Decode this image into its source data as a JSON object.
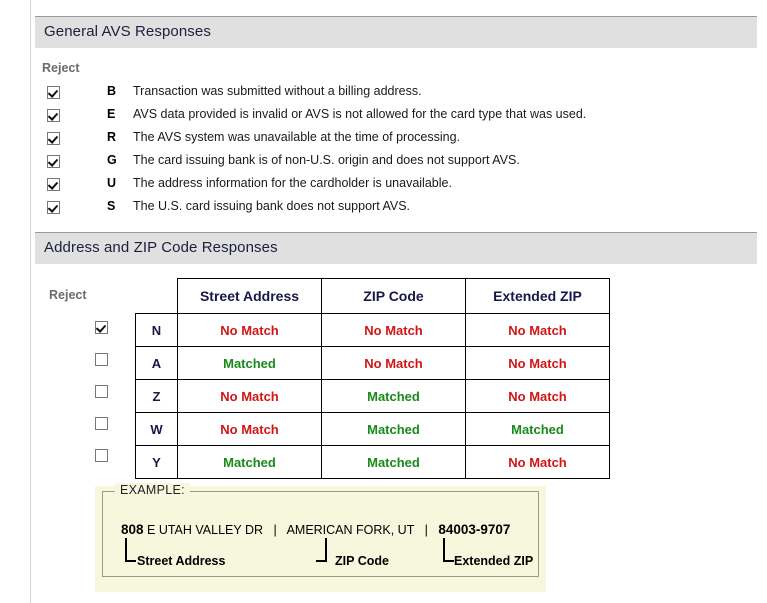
{
  "sections": {
    "general": {
      "title": "General AVS Responses",
      "reject_label": "Reject",
      "rows": [
        {
          "checked": true,
          "code": "B",
          "text": "Transaction was submitted without a billing address."
        },
        {
          "checked": true,
          "code": "E",
          "text": "AVS data provided is invalid or AVS is not allowed for the card type that was used."
        },
        {
          "checked": true,
          "code": "R",
          "text": "The AVS system was unavailable at the time of processing."
        },
        {
          "checked": true,
          "code": "G",
          "text": "The card issuing bank is of non-U.S. origin and does not support AVS."
        },
        {
          "checked": true,
          "code": "U",
          "text": "The address information for the cardholder is unavailable."
        },
        {
          "checked": true,
          "code": "S",
          "text": "The U.S. card issuing bank does not support AVS."
        }
      ]
    },
    "address": {
      "title": "Address and ZIP Code Responses",
      "reject_label": "Reject",
      "columns": [
        "Street Address",
        "ZIP Code",
        "Extended ZIP"
      ],
      "rows": [
        {
          "checked": true,
          "code": "N",
          "values": [
            "No Match",
            "No Match",
            "No Match"
          ]
        },
        {
          "checked": false,
          "code": "A",
          "values": [
            "Matched",
            "No Match",
            "No Match"
          ]
        },
        {
          "checked": false,
          "code": "Z",
          "values": [
            "No Match",
            "Matched",
            "No Match"
          ]
        },
        {
          "checked": false,
          "code": "W",
          "values": [
            "No Match",
            "Matched",
            "Matched"
          ]
        },
        {
          "checked": false,
          "code": "Y",
          "values": [
            "Matched",
            "Matched",
            "No Match"
          ]
        }
      ]
    }
  },
  "example": {
    "legend": "EXAMPLE:",
    "street_number": "808",
    "street_name": "E UTAH VALLEY DR",
    "separator": "|",
    "city_state": "AMERICAN FORK, UT",
    "zip": "84003",
    "zip_dash": "-",
    "extended_zip": "9707",
    "label_street": "Street Address",
    "label_zip": "ZIP Code",
    "label_extzip": "Extended ZIP"
  },
  "colors": {
    "matched": "#1a8a1a",
    "no_match": "#d01616",
    "header_bar": "#e0e0e0",
    "example_bg": "#f7f7dd"
  }
}
